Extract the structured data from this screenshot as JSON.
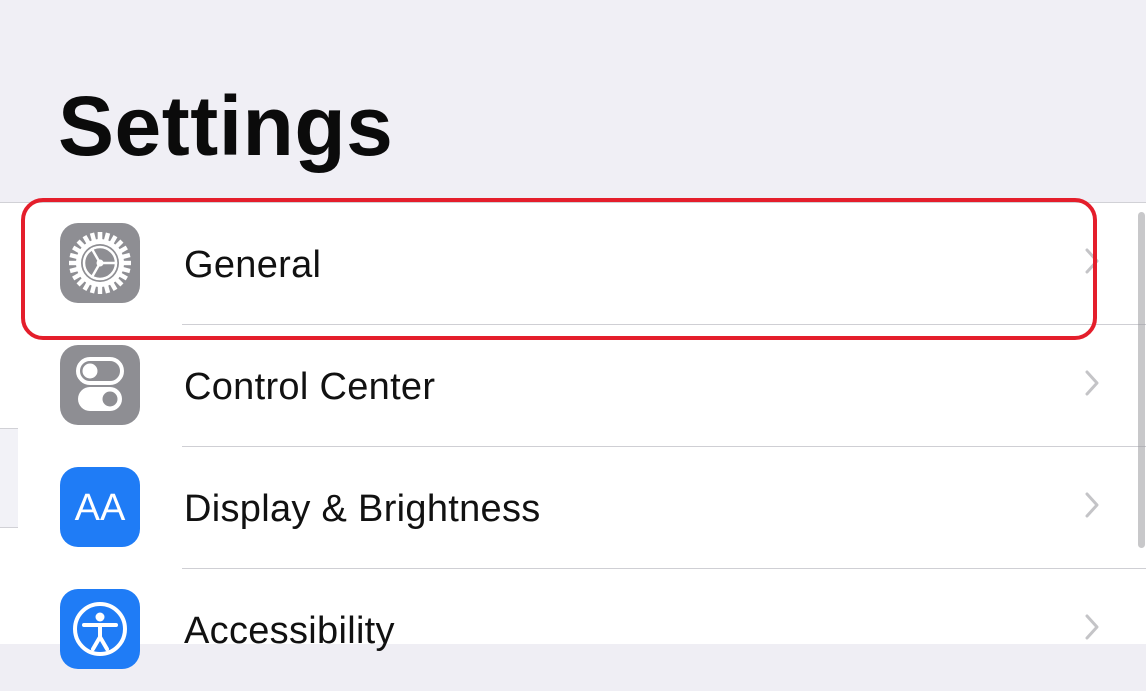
{
  "header": {
    "title": "Settings"
  },
  "rows": [
    {
      "label": "General",
      "icon": "gear-icon",
      "icon_bg": "#8e8e93"
    },
    {
      "label": "Control Center",
      "icon": "toggles-icon",
      "icon_bg": "#8e8e93"
    },
    {
      "label": "Display & Brightness",
      "icon": "text-size-icon",
      "icon_bg": "#1f7cf6",
      "icon_text": "AA"
    },
    {
      "label": "Accessibility",
      "icon": "accessibility-icon",
      "icon_bg": "#1f7cf6"
    }
  ],
  "highlight": {
    "target": "General",
    "color": "#e41e2b"
  },
  "colors": {
    "header_bg": "#f0eff5",
    "list_bg": "#ffffff",
    "chevron": "#c4c4c7"
  }
}
